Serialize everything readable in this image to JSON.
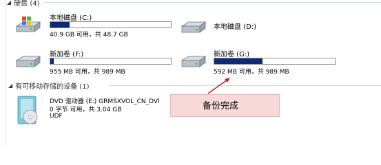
{
  "hard_disk_group": {
    "title": "硬盘 (4)"
  },
  "drives": [
    {
      "name": "本地磁盘 (C:)",
      "info": "40.9 GB 可用，共 48.7 GB",
      "usage_fraction": 0.16
    },
    {
      "name": "本地磁盘 (D:)",
      "info": "",
      "usage_fraction": null
    },
    {
      "name": "新加卷 (F:)",
      "info": "955 MB 可用，共 989 MB",
      "usage_fraction": 0.03
    },
    {
      "name": "新加卷 (G:)",
      "info": "592 MB 可用，共 989 MB",
      "usage_fraction": 0.4
    }
  ],
  "removable_group": {
    "title": "有可移动存储的设备 (1)"
  },
  "dvd": {
    "name": "DVD 驱动器 (E:) GRMSXVOL_CN_DVI",
    "info": "0 字节 可用，共 3.04 GB",
    "fs": "UDF"
  },
  "annotation": {
    "text": "备份完成",
    "color": "#c8202a"
  },
  "colors": {
    "bar_fill": "#0d2a7a",
    "note_bg": "#f7d9d9"
  }
}
